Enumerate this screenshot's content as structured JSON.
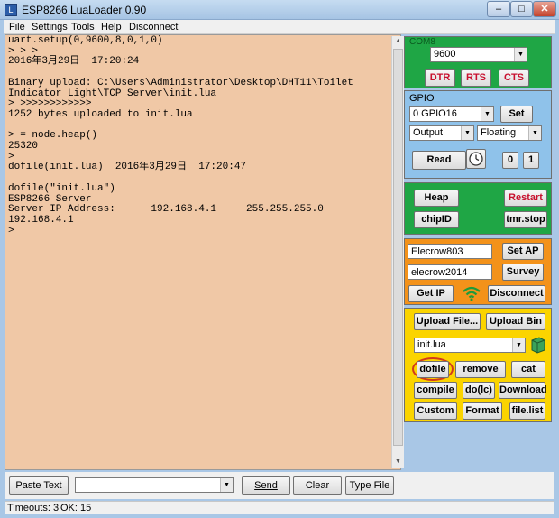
{
  "window": {
    "title": "ESP8266 LuaLoader 0.90",
    "icon_glyph": "L",
    "minimize_label": "–",
    "maximize_label": "□",
    "close_label": "✕"
  },
  "menu": [
    "File",
    "Settings",
    "Tools",
    "Help",
    "Disconnect"
  ],
  "console": {
    "text": "uart.setup(0,9600,8,0,1,0)\n> > >\n2016年3月29日  17:20:24\n\nBinary upload: C:\\Users\\Administrator\\Desktop\\DHT11\\Toilet\nIndicator Light\\TCP Server\\init.lua\n> >>>>>>>>>>>>\n1252 bytes uploaded to init.lua\n\n> = node.heap()\n25320\n>\ndofile(init.lua)  2016年3月29日  17:20:47\n\ndofile(\"init.lua\")\nESP8266 Server\nServer IP Address:      192.168.4.1     255.255.255.0\n192.168.4.1\n>"
  },
  "com": {
    "label": "COM8",
    "baud": "9600",
    "dtr": "DTR",
    "rts": "RTS",
    "cts": "CTS"
  },
  "gpio": {
    "label": "GPIO",
    "pin": "0 GPIO16",
    "set": "Set",
    "mode": "Output",
    "pull": "Floating",
    "read": "Read",
    "clock_icon": "clock-icon",
    "btn0": "0",
    "btn1": "1"
  },
  "node": {
    "heap": "Heap",
    "restart": "Restart",
    "chipid": "chipID",
    "tmrstop": "tmr.stop"
  },
  "wifi": {
    "ssid": "Elecrow803",
    "password": "elecrow2014",
    "set_ap": "Set AP",
    "survey": "Survey",
    "get_ip": "Get IP",
    "wifi_icon": "wifi-icon",
    "disconnect": "Disconnect"
  },
  "files": {
    "upload_file": "Upload File...",
    "upload_bin": "Upload Bin",
    "file": "init.lua",
    "dofile": "dofile",
    "remove": "remove",
    "cat": "cat",
    "compile": "compile",
    "dolc": "do(lc)",
    "download": "Download",
    "custom": "Custom",
    "format": "Format",
    "filelist": "file.list"
  },
  "bottom": {
    "paste_text": "Paste Text",
    "command_value": "",
    "send": "Send",
    "clear": "Clear",
    "type_file": "Type File"
  },
  "status": {
    "timeouts": "Timeouts: 3",
    "ok": "OK: 15"
  },
  "colors": {
    "com_panel": "#1fa645",
    "gpio_panel": "#8fc2ea",
    "node_panel": "#1fa645",
    "wifi_panel": "#f3921a",
    "files_panel": "#fbd400",
    "console_bg": "#f0c8a6",
    "highlight_ring": "#d23a1a"
  }
}
